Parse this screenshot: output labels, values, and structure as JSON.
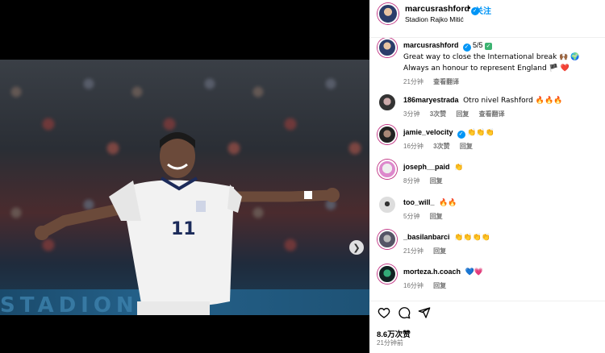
{
  "post": {
    "username": "marcusrashford",
    "follow_label": "关注",
    "separator": "•",
    "location": "Stadion Rajko Mitić",
    "banner_text": "STADION",
    "jersey_number": "11"
  },
  "caption": {
    "username": "marcusrashford",
    "counter": "5/5",
    "text": "Great way to close the International break 🙌🏾 🌍  Always an honour to represent England 🏴 ❤️",
    "time": "21分钟",
    "translate": "查看翻译"
  },
  "comments": [
    {
      "username": "186maryestrada",
      "text": "Otro nivel Rashford 🔥🔥🔥",
      "time": "3分钟",
      "likes": "3次赞",
      "reply": "回复",
      "translate": "查看翻译",
      "verified": false
    },
    {
      "username": "jamie_velocity",
      "text": "👏👏👏",
      "time": "16分钟",
      "likes": "3次赞",
      "reply": "回复",
      "translate": "",
      "verified": true
    },
    {
      "username": "joseph__paid",
      "text": "👏",
      "time": "8分钟",
      "likes": "",
      "reply": "回复",
      "translate": "",
      "verified": false
    },
    {
      "username": "too_will_",
      "text": "🔥🔥",
      "time": "5分钟",
      "likes": "",
      "reply": "回复",
      "translate": "",
      "verified": false
    },
    {
      "username": "_basilanbarci",
      "text": "👏👏👏👏",
      "time": "21分钟",
      "likes": "",
      "reply": "回复",
      "translate": "",
      "verified": false
    },
    {
      "username": "morteza.h.coach",
      "text": "💙💗",
      "time": "16分钟",
      "likes": "",
      "reply": "回复",
      "translate": "",
      "verified": false
    }
  ],
  "footer": {
    "likes": "8.6万次赞",
    "time": "21分钟前"
  },
  "colors": {
    "accent": "#0095f6",
    "muted": "#737373"
  }
}
